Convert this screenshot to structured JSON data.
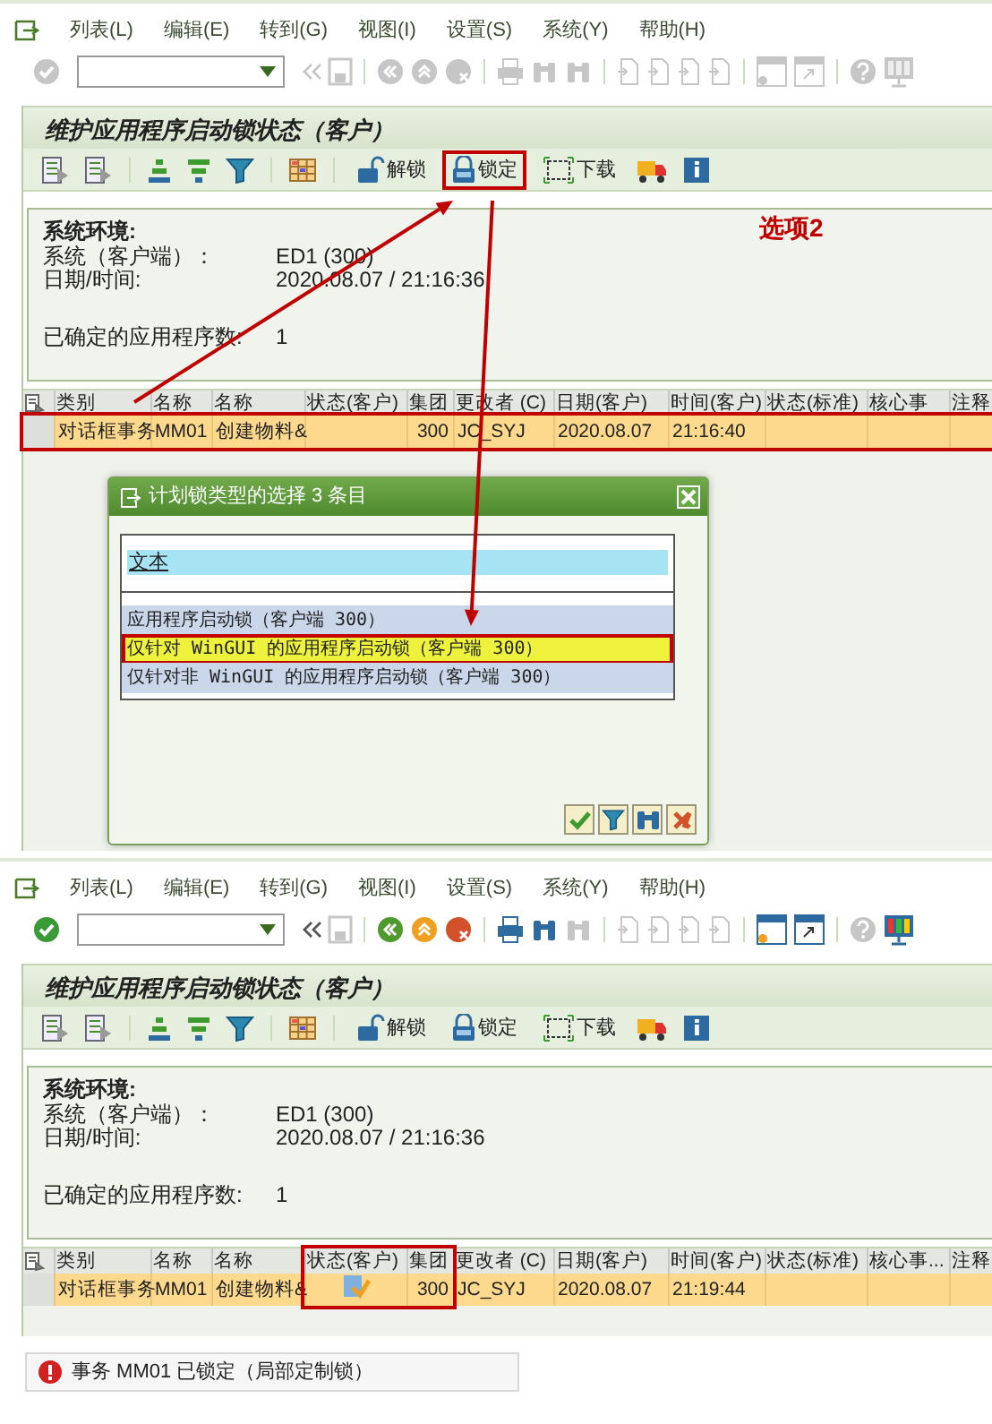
{
  "screens": [
    {
      "menu": [
        "列表(L)",
        "编辑(E)",
        "转到(G)",
        "视图(I)",
        "设置(S)",
        "系统(Y)",
        "帮助(H)"
      ],
      "std_toolbar": [
        {
          "kind": "enter",
          "disabled": true
        },
        {
          "kind": "command-field"
        },
        {
          "kind": "nav-first",
          "disabled": true
        },
        {
          "kind": "save",
          "disabled": true
        },
        {
          "kind": "separator"
        },
        {
          "kind": "back",
          "disabled": true
        },
        {
          "kind": "exit",
          "disabled": true
        },
        {
          "kind": "cancel",
          "disabled": true
        },
        {
          "kind": "separator"
        },
        {
          "kind": "print",
          "disabled": true
        },
        {
          "kind": "find",
          "disabled": true
        },
        {
          "kind": "find",
          "disabled": true
        },
        {
          "kind": "separator"
        },
        {
          "kind": "page",
          "disabled": true
        },
        {
          "kind": "page",
          "disabled": true
        },
        {
          "kind": "page",
          "disabled": true
        },
        {
          "kind": "page",
          "disabled": true
        },
        {
          "kind": "separator"
        },
        {
          "kind": "new-session",
          "disabled": true
        },
        {
          "kind": "shortcut",
          "disabled": true
        },
        {
          "kind": "separator"
        },
        {
          "kind": "help",
          "disabled": true
        },
        {
          "kind": "layout",
          "disabled": true
        }
      ],
      "title": "维护应用程序启动锁状态（客户）",
      "app_toolbar": [
        {
          "kind": "details"
        },
        {
          "kind": "details"
        },
        {
          "kind": "separator"
        },
        {
          "kind": "sort-asc"
        },
        {
          "kind": "sort-desc"
        },
        {
          "kind": "filter"
        },
        {
          "kind": "separator"
        },
        {
          "kind": "grid"
        },
        {
          "kind": "separator"
        },
        {
          "kind": "unlock",
          "label": "解锁",
          "boxed": false
        },
        {
          "kind": "lock",
          "label": "锁定",
          "boxed": true
        },
        {
          "kind": "download",
          "label": "下载",
          "boxed": false
        },
        {
          "kind": "truck"
        },
        {
          "kind": "info"
        }
      ],
      "note": "选项2",
      "info": {
        "heading": "系统环境:",
        "rows": [
          {
            "label": "系统（客户端）：",
            "value": "ED1 (300)"
          },
          {
            "label": "日期/时间:",
            "value": "2020.08.07 / 21:16:36"
          }
        ],
        "count": {
          "label": "已确定的应用程序数:",
          "value": "1"
        }
      },
      "table": {
        "columns": [
          {
            "label": "类别",
            "boxed": false
          },
          {
            "label": "名称",
            "boxed": false
          },
          {
            "label": "名称",
            "boxed": false
          },
          {
            "label": "状态(客户)",
            "boxed": false
          },
          {
            "label": "集团",
            "boxed": false
          },
          {
            "label": "更改者 (C)",
            "boxed": false
          },
          {
            "label": "日期(客户)",
            "boxed": false
          },
          {
            "label": "时间(客户)",
            "boxed": false
          },
          {
            "label": "状态(标准)",
            "boxed": false
          },
          {
            "label": "核心事",
            "boxed": false
          },
          {
            "label": "注释",
            "boxed": false
          }
        ],
        "rows": [
          {
            "cells": [
              "对话框事务",
              "MM01",
              "创建物料&",
              null,
              "300",
              "JC_SYJ",
              "2020.08.07",
              "21:16:40",
              null,
              null,
              null
            ],
            "locked": false,
            "boxed": true
          }
        ]
      },
      "dialog": {
        "title": "计划锁类型的选择 3 条目",
        "header": "文本",
        "items": [
          {
            "text": "应用程序启动锁（客户端 300）",
            "selected": false
          },
          {
            "text": "仅针对 WinGUI 的应用程序启动锁（客户端 300）",
            "selected": true
          },
          {
            "text": "仅针对非 WinGUI 的应用程序启动锁（客户端 300）",
            "selected": false
          }
        ],
        "buttons": [
          {
            "kind": "ok"
          },
          {
            "kind": "filter"
          },
          {
            "kind": "find"
          },
          {
            "kind": "cancel"
          }
        ]
      }
    },
    {
      "menu": [
        "列表(L)",
        "编辑(E)",
        "转到(G)",
        "视图(I)",
        "设置(S)",
        "系统(Y)",
        "帮助(H)"
      ],
      "std_toolbar": [
        {
          "kind": "enter",
          "disabled": false
        },
        {
          "kind": "command-field"
        },
        {
          "kind": "nav-first",
          "disabled": false
        },
        {
          "kind": "save",
          "disabled": true
        },
        {
          "kind": "separator"
        },
        {
          "kind": "back",
          "disabled": false
        },
        {
          "kind": "exit",
          "disabled": false
        },
        {
          "kind": "cancel",
          "disabled": false
        },
        {
          "kind": "separator"
        },
        {
          "kind": "print",
          "disabled": false
        },
        {
          "kind": "find",
          "disabled": false
        },
        {
          "kind": "find",
          "disabled": true
        },
        {
          "kind": "separator"
        },
        {
          "kind": "page",
          "disabled": true
        },
        {
          "kind": "page",
          "disabled": true
        },
        {
          "kind": "page",
          "disabled": true
        },
        {
          "kind": "page",
          "disabled": true
        },
        {
          "kind": "separator"
        },
        {
          "kind": "new-session",
          "disabled": false
        },
        {
          "kind": "shortcut",
          "disabled": false
        },
        {
          "kind": "separator"
        },
        {
          "kind": "help",
          "disabled": true
        },
        {
          "kind": "layout",
          "disabled": false
        }
      ],
      "title": "维护应用程序启动锁状态（客户）",
      "app_toolbar": [
        {
          "kind": "details"
        },
        {
          "kind": "details"
        },
        {
          "kind": "separator"
        },
        {
          "kind": "sort-asc"
        },
        {
          "kind": "sort-desc"
        },
        {
          "kind": "filter"
        },
        {
          "kind": "separator"
        },
        {
          "kind": "grid"
        },
        {
          "kind": "separator"
        },
        {
          "kind": "unlock",
          "label": "解锁",
          "boxed": false
        },
        {
          "kind": "lock",
          "label": "锁定",
          "boxed": false
        },
        {
          "kind": "download",
          "label": "下载",
          "boxed": false
        },
        {
          "kind": "truck"
        },
        {
          "kind": "info"
        }
      ],
      "info": {
        "heading": "系统环境:",
        "rows": [
          {
            "label": "系统（客户端）：",
            "value": "ED1 (300)"
          },
          {
            "label": "日期/时间:",
            "value": "2020.08.07 / 21:16:36"
          }
        ],
        "count": {
          "label": "已确定的应用程序数:",
          "value": "1"
        }
      },
      "table": {
        "columns": [
          {
            "label": "类别",
            "boxed": false
          },
          {
            "label": "名称",
            "boxed": false
          },
          {
            "label": "名称",
            "boxed": false
          },
          {
            "label": "状态(客户)",
            "boxed": true
          },
          {
            "label": "集团",
            "boxed": true
          },
          {
            "label": "更改者 (C)",
            "boxed": false
          },
          {
            "label": "日期(客户)",
            "boxed": false
          },
          {
            "label": "时间(客户)",
            "boxed": false
          },
          {
            "label": "状态(标准)",
            "boxed": false
          },
          {
            "label": "核心事...",
            "boxed": false
          },
          {
            "label": "注释",
            "boxed": false
          }
        ],
        "rows": [
          {
            "cells": [
              "对话框事务",
              "MM01",
              "创建物料&",
              null,
              "300",
              "JC_SYJ",
              "2020.08.07",
              "21:19:44",
              null,
              null,
              null
            ],
            "locked": true,
            "boxed": false
          }
        ]
      },
      "status_bar": {
        "kind": "error",
        "text": "事务 MM01 已锁定（局部定制锁）"
      }
    }
  ]
}
